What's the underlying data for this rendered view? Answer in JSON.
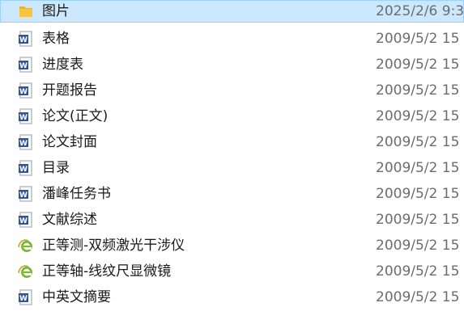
{
  "files": [
    {
      "name": "图片",
      "date": "2025/2/6 9:3",
      "icon": "folder-icon",
      "selected": true
    },
    {
      "name": "表格",
      "date": "2009/5/2 15",
      "icon": "word-doc-icon"
    },
    {
      "name": "进度表",
      "date": "2009/5/2 15",
      "icon": "word-doc-icon"
    },
    {
      "name": "开题报告",
      "date": "2009/5/2 15",
      "icon": "word-doc-icon"
    },
    {
      "name": "论文(正文)",
      "date": "2009/5/2 15",
      "icon": "word-doc-icon"
    },
    {
      "name": "论文封面",
      "date": "2009/5/2 15",
      "icon": "word-doc-icon"
    },
    {
      "name": "目录",
      "date": "2009/5/2 15",
      "icon": "word-doc-icon"
    },
    {
      "name": "潘峰任务书",
      "date": "2009/5/2 15",
      "icon": "word-doc-icon"
    },
    {
      "name": "文献综述",
      "date": "2009/5/2 15",
      "icon": "word-doc-icon"
    },
    {
      "name": "正等测-双频激光干涉仪",
      "date": "2009/5/2 15",
      "icon": "ie-web-icon"
    },
    {
      "name": "正等轴-线纹尺显微镜",
      "date": "2009/5/2 15",
      "icon": "ie-web-icon"
    },
    {
      "name": "中英文摘要",
      "date": "2009/5/2 15",
      "icon": "word-doc-icon"
    }
  ],
  "colors": {
    "selection_bg": "#cce8ff",
    "selection_border": "#99d1ff",
    "word_blue": "#2b5797",
    "folder_yellow": "#f6c342",
    "ie_green": "#7cb82f"
  }
}
